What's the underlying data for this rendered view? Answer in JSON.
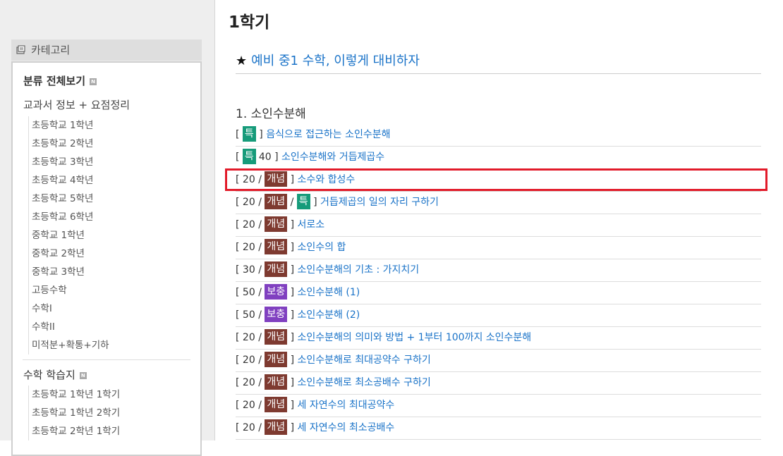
{
  "sidebar": {
    "category_header": "카테고리",
    "category_icon": "folder-icon",
    "section1": {
      "title": "분류 전체보기",
      "badge": "N",
      "subtitle": "교과서 정보 + 요점정리",
      "items": [
        "초등학교 1학년",
        "초등학교 2학년",
        "초등학교 3학년",
        "초등학교 4학년",
        "초등학교 5학년",
        "초등학교 6학년",
        "중학교 1학년",
        "중학교 2학년",
        "중학교 3학년",
        "고등수학",
        "수학I",
        "수학II",
        "미적분+확통+기하"
      ]
    },
    "section2": {
      "title": "수학 학습지",
      "badge": "N",
      "items": [
        "초등학교 1학년 1학기",
        "초등학교 1학년 2학기",
        "초등학교 2학년 1학기"
      ]
    }
  },
  "main": {
    "page_title": "1학기",
    "preface_star": "★",
    "preface_link": "예비 중1 수학, 이렇게 대비하자",
    "section_heading": "1. 소인수분해",
    "rows": [
      {
        "num": "",
        "tags": [
          {
            "label": "특",
            "kind": "teuk"
          }
        ],
        "text": "음식으로 접근하는 소인수분해"
      },
      {
        "num": "",
        "tags": [
          {
            "label": "특",
            "kind": "teuk"
          }
        ],
        "after": "40",
        "text": "소인수분해와 거듭제곱수"
      },
      {
        "num": "20",
        "tags": [
          {
            "label": "개념",
            "kind": "gaenyeom"
          }
        ],
        "text": "소수와 합성수"
      },
      {
        "num": "20",
        "tags": [
          {
            "label": "개념",
            "kind": "gaenyeom"
          },
          {
            "label": "특",
            "kind": "teuk"
          }
        ],
        "text": "거듭제곱의 일의 자리 구하기"
      },
      {
        "num": "20",
        "tags": [
          {
            "label": "개념",
            "kind": "gaenyeom"
          }
        ],
        "text": "서로소"
      },
      {
        "num": "20",
        "tags": [
          {
            "label": "개념",
            "kind": "gaenyeom"
          }
        ],
        "text": "소인수의 합"
      },
      {
        "num": "30",
        "tags": [
          {
            "label": "개념",
            "kind": "gaenyeom"
          }
        ],
        "text": "소인수분해의 기초 : 가지치기"
      },
      {
        "num": "50",
        "tags": [
          {
            "label": "보충",
            "kind": "bochung"
          }
        ],
        "text": "소인수분해 (1)"
      },
      {
        "num": "50",
        "tags": [
          {
            "label": "보충",
            "kind": "bochung"
          }
        ],
        "text": "소인수분해 (2)"
      },
      {
        "num": "20",
        "tags": [
          {
            "label": "개념",
            "kind": "gaenyeom"
          }
        ],
        "text": "소인수분해의 의미와 방법 + 1부터 100까지 소인수분해"
      },
      {
        "num": "20",
        "tags": [
          {
            "label": "개념",
            "kind": "gaenyeom"
          }
        ],
        "text": "소인수분해로 최대공약수 구하기"
      },
      {
        "num": "20",
        "tags": [
          {
            "label": "개념",
            "kind": "gaenyeom"
          }
        ],
        "text": "소인수분해로 최소공배수 구하기"
      },
      {
        "num": "20",
        "tags": [
          {
            "label": "개념",
            "kind": "gaenyeom"
          }
        ],
        "text": "세 자연수의 최대공약수"
      },
      {
        "num": "20",
        "tags": [
          {
            "label": "개념",
            "kind": "gaenyeom"
          }
        ],
        "text": "세 자연수의 최소공배수"
      }
    ]
  },
  "colors": {
    "link": "#1a73c8",
    "teuk": "#169b7a",
    "gaenyeom": "#7e3a30",
    "bochung": "#8040c0",
    "highlight": "#e21b2a"
  }
}
